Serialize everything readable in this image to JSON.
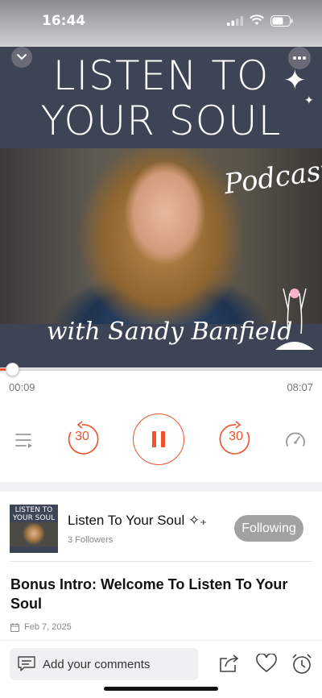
{
  "status": {
    "time": "16:44"
  },
  "cover": {
    "title_line1": "LISTEN TO",
    "title_line2": "YOUR SOUL",
    "tag": "Podcast",
    "host": "with Sandy Banfield"
  },
  "player": {
    "elapsed": "00:09",
    "total": "08:07",
    "progress_fraction": 0.018,
    "skip_back_seconds": "30",
    "skip_forward_seconds": "30",
    "state": "playing"
  },
  "podcast": {
    "name": "Listen To Your Soul ✧₊",
    "followers": "3 Followers",
    "follow_label": "Following",
    "thumb_title": "LISTEN TO YOUR SOUL"
  },
  "episode": {
    "title": "Bonus Intro: Welcome To Listen To Your Soul",
    "date": "Feb 7, 2025"
  },
  "comments": {
    "placeholder": "Add your comments"
  },
  "colors": {
    "accent": "#f0532b",
    "cover_band": "#3d4456",
    "follow_button": "#a2a2a2"
  }
}
